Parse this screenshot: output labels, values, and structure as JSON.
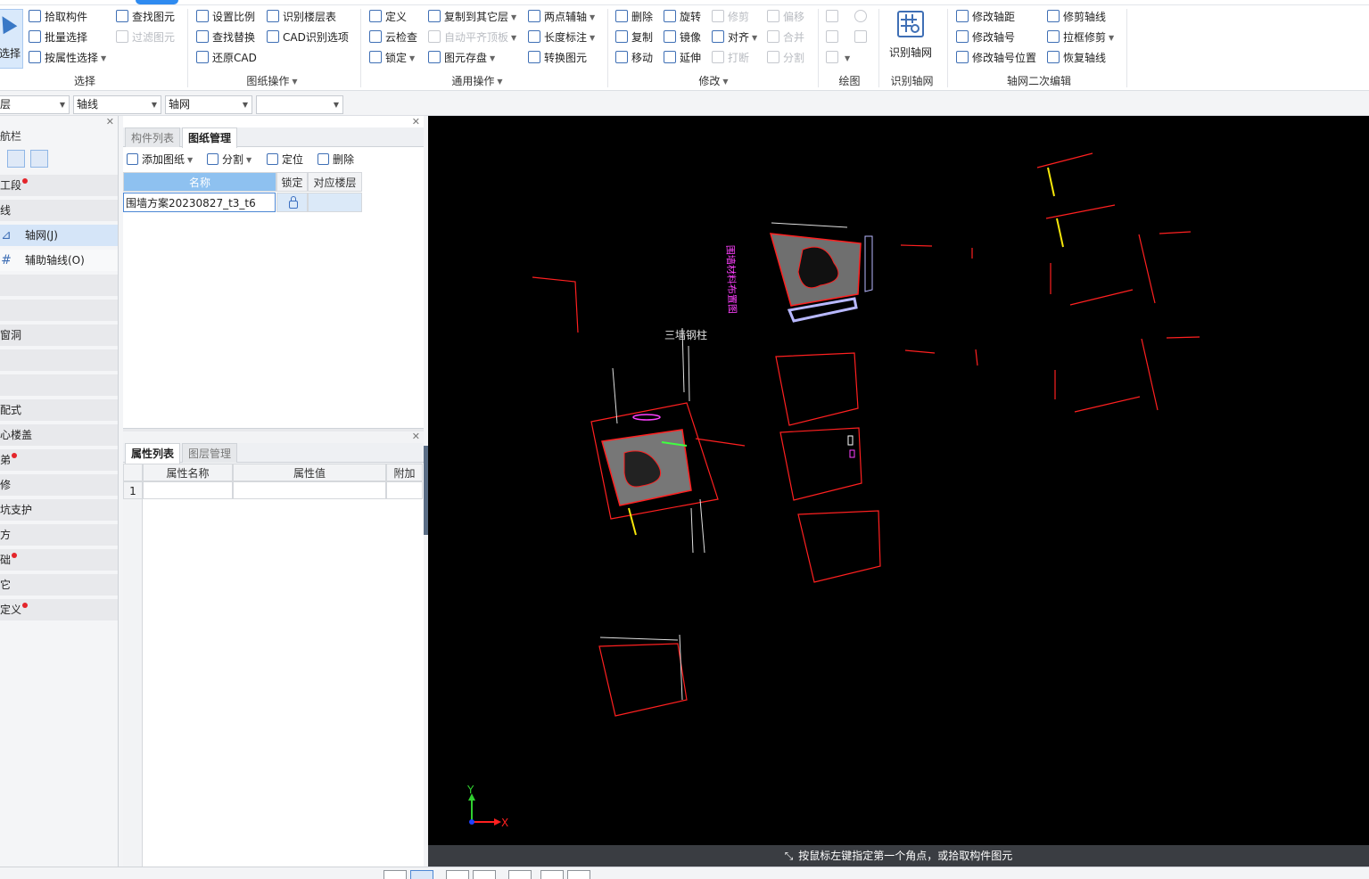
{
  "ribbon": {
    "select_group": {
      "big_button": "选择",
      "items": [
        "拾取构件",
        "批量选择",
        "按属性选择",
        "查找图元",
        "过滤图元"
      ],
      "title": "选择"
    },
    "drawing_ops": {
      "items": [
        "设置比例",
        "查找替换",
        "还原CAD",
        "识别楼层表",
        "CAD识别选项"
      ],
      "title": "图纸操作"
    },
    "common_ops": {
      "items": [
        "定义",
        "云检查",
        "锁定",
        "复制到其它层",
        "自动平齐顶板",
        "图元存盘",
        "两点辅轴",
        "长度标注",
        "转换图元"
      ],
      "title": "通用操作"
    },
    "modify": {
      "items": [
        "删除",
        "复制",
        "移动",
        "旋转",
        "镜像",
        "延伸",
        "修剪",
        "对齐",
        "打断",
        "偏移",
        "合并",
        "分割"
      ],
      "title": "修改"
    },
    "draw": {
      "title": "绘图"
    },
    "identify_grid": {
      "big_button": "识别轴网",
      "title": "识别轴网"
    },
    "grid_edit": {
      "items": [
        "修改轴距",
        "修改轴号",
        "修改轴号位置",
        "修剪轴线",
        "拉框修剪",
        "恢复轴线"
      ],
      "title": "轴网二次编辑"
    }
  },
  "filterbar": {
    "combos": [
      "层",
      "轴线",
      "轴网",
      ""
    ]
  },
  "nav": {
    "title": "航栏",
    "rows": [
      {
        "label": "工段",
        "dot": true
      },
      {
        "label": "线",
        "dot": false
      },
      {
        "label": "轴网(J)",
        "dot": false
      },
      {
        "label": "辅助轴线(O)",
        "dot": false
      },
      {
        "label": "",
        "dot": false
      },
      {
        "label": "",
        "dot": false
      },
      {
        "label": "窗洞",
        "dot": false
      },
      {
        "label": "",
        "dot": false
      },
      {
        "label": "",
        "dot": false
      },
      {
        "label": "配式",
        "dot": false
      },
      {
        "label": "心楼盖",
        "dot": false
      },
      {
        "label": "弟",
        "dot": true
      },
      {
        "label": "修",
        "dot": false
      },
      {
        "label": "坑支护",
        "dot": false
      },
      {
        "label": "方",
        "dot": false
      },
      {
        "label": "础",
        "dot": true
      },
      {
        "label": "它",
        "dot": false
      },
      {
        "label": "定义",
        "dot": true
      }
    ]
  },
  "drawing_panel": {
    "tabs": [
      "构件列表",
      "图纸管理"
    ],
    "toolbar": [
      "添加图纸",
      "分割",
      "定位",
      "删除"
    ],
    "columns": [
      "名称",
      "锁定",
      "对应楼层"
    ],
    "rows": [
      {
        "name": "围墙方案20230827_t3_t6",
        "floor": ""
      }
    ]
  },
  "property_panel": {
    "tabs": [
      "属性列表",
      "图层管理"
    ],
    "columns": [
      "属性名称",
      "属性值",
      "附加"
    ],
    "rows": [
      {
        "index": "1",
        "name": "",
        "value": "",
        "extra": ""
      }
    ]
  },
  "canvas": {
    "axis_y": "Y",
    "axis_x": "X",
    "vertical_text_1": "围墙材料布置图",
    "label_1": "三墙钢柱"
  },
  "command_prompt": "按鼠标左键指定第一个角点，或拾取构件图元",
  "colors": {
    "accent": "#2f8bf0",
    "canvas_bg": "#000000",
    "cad_red": "#ff2020",
    "cad_magenta": "#ff40ff",
    "cad_yellow": "#f5e60a"
  }
}
